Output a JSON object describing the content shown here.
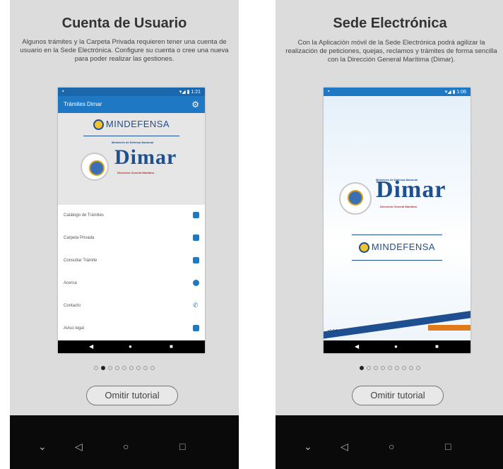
{
  "panels": [
    {
      "title": "Cuenta de Usuario",
      "description": "Algunos trámites y la Carpeta Privada requieren tener una cuenta de usuario en la Sede Electrónica. Configure su cuenta o cree una nueva para poder realizar las gestiones.",
      "app_title": "Trámites Dimar",
      "mindefensa": "MINDEFENSA",
      "dimar": "Dimar",
      "dimar_top": "Ministerio de Defensa Nacional",
      "dimar_sub": "Dirección General Marítima",
      "menu": [
        {
          "label": "Catálogo de Trámites",
          "icon": "list-icon"
        },
        {
          "label": "Carpeta Privada",
          "icon": "folder-icon"
        },
        {
          "label": "Consultar Trámite",
          "icon": "search-doc-icon"
        },
        {
          "label": "Acerca",
          "icon": "info-icon"
        },
        {
          "label": "Contacto",
          "icon": "phone-icon"
        },
        {
          "label": "Aviso legal",
          "icon": "lock-icon"
        }
      ],
      "active_dot": 1,
      "skip_label": "Omitir tutorial"
    },
    {
      "title": "Sede Electrónica",
      "description": "Con la Aplicación móvil de la Sede Electrónica podrá agilizar la realización de peticiones, quejas, reclamos y trámites de forma sencilla con la Dirección General Marítima (Dimar).",
      "mindefensa": "MINDEFENSA",
      "dimar": "Dimar",
      "dimar_top": "Ministerio de Defensa Nacional",
      "dimar_sub": "Dirección General Marítima",
      "version": "v1.0.0",
      "active_dot": 0,
      "skip_label": "Omitir tutorial"
    }
  ],
  "colors": {
    "primary": "#1f78c4",
    "brand": "#1d4f91",
    "accent": "#e07b1a"
  }
}
